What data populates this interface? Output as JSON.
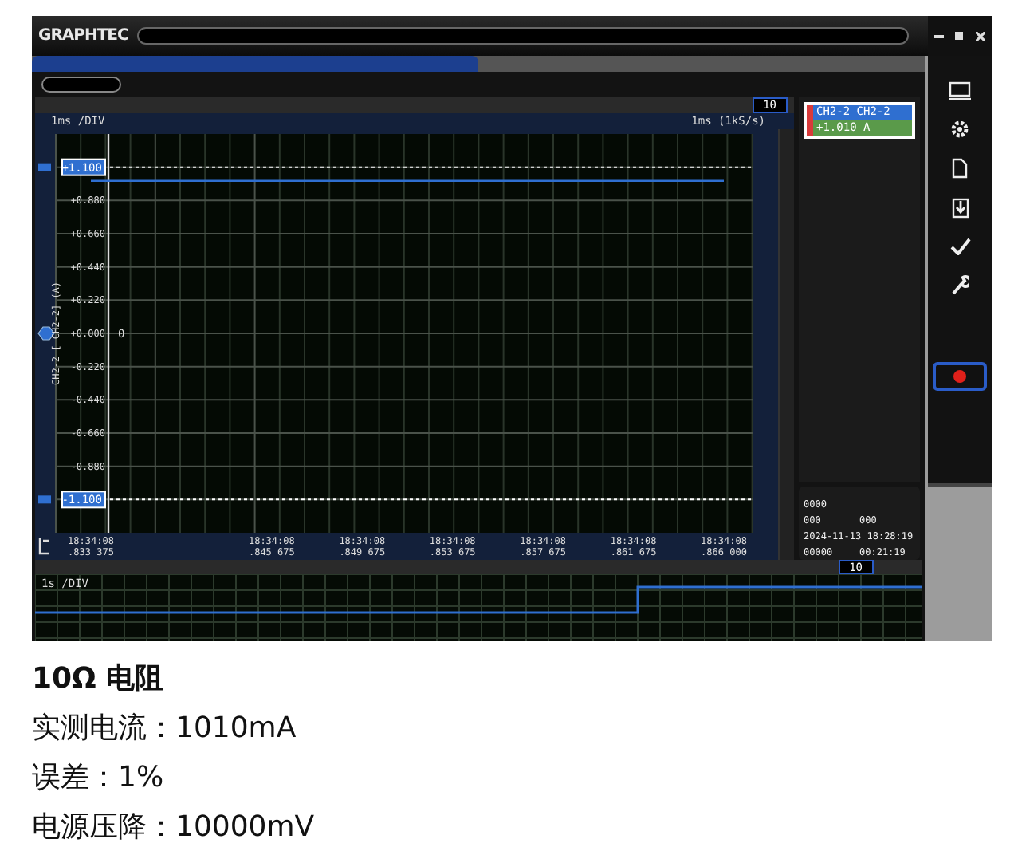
{
  "app": {
    "logo": "GRAPHTEC"
  },
  "chart_panel": {
    "zoom": "10",
    "scale": "1ms",
    "div": "/DIV",
    "rate": "1ms (1kS/s)",
    "axis_label": "CH2-2 [ CH2-2] (A)",
    "zero_marker": "0",
    "chart_data": {
      "type": "line",
      "grid": true,
      "categories": [
        "18:34:08\n.833 375",
        null,
        "18:34:08\n.845 675",
        "18:34:08\n.849 675",
        "18:34:08\n.853 675",
        "18:34:08\n.857 675",
        "18:34:08\n.861 675",
        "18:34:08\n.866 000"
      ],
      "ylim": [
        -1.32,
        1.32
      ],
      "yticks": [
        {
          "value": 1.1,
          "label": "+1.100"
        },
        {
          "value": 0.88,
          "label": "+0.880"
        },
        {
          "value": 0.66,
          "label": "+0.660"
        },
        {
          "value": 0.44,
          "label": "+0.440"
        },
        {
          "value": 0.22,
          "label": "+0.220"
        },
        {
          "value": 0,
          "label": "+0.000"
        },
        {
          "value": -0.22,
          "label": "-0.220"
        },
        {
          "value": -0.44,
          "label": "-0.440"
        },
        {
          "value": -0.66,
          "label": "-0.660"
        },
        {
          "value": -0.88,
          "label": "-0.880"
        },
        {
          "value": -1.1,
          "label": "-1.100"
        }
      ],
      "series": [
        {
          "color": "#2f6fd0",
          "values": [
            1.01,
            1.01,
            1.01,
            1.01,
            1.01,
            1.01,
            1.01,
            1.01
          ]
        }
      ]
    }
  },
  "channels": [
    {
      "name": "CH2-2 CH2-2",
      "value": "+1.010 A",
      "color": "#d83a3a"
    }
  ],
  "info": {
    "count": "0000",
    "in_count": "000",
    "out_count": "000",
    "datetime": "2024-11-13 18:28:19",
    "counter": "00000",
    "elapsed": "00:21:19"
  },
  "overview": {
    "zoom": "10",
    "scale": "1s",
    "div": "/DIV"
  },
  "caption": {
    "title": "10Ω 电阻",
    "lines": [
      "实测电流：1010mA",
      "误差：1%",
      "电源压降：10000mV"
    ]
  }
}
